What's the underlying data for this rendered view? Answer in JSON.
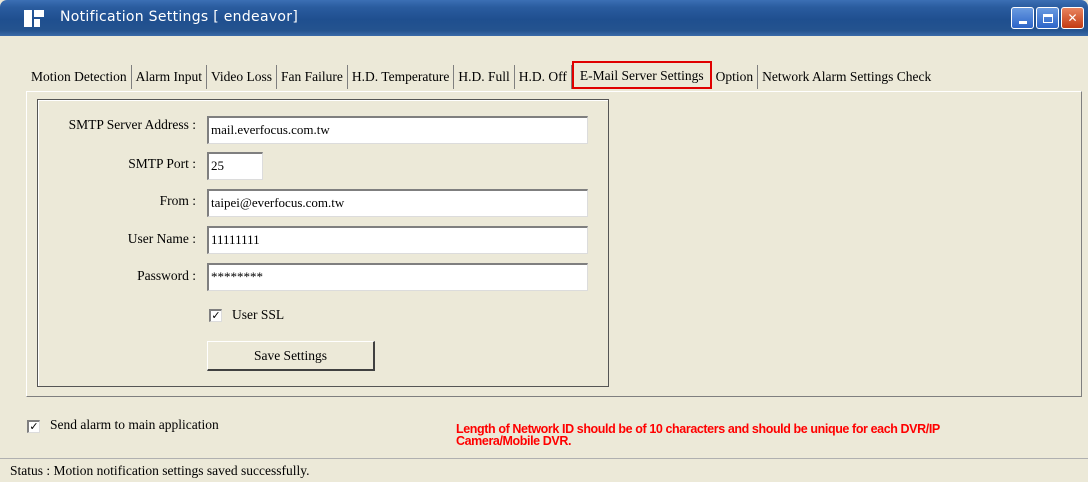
{
  "window": {
    "title": "Notification Settings  [ endeavor]",
    "min_icon": "minimize-icon",
    "max_icon": "maximize-icon",
    "close_icon": "close-icon"
  },
  "tabs": [
    {
      "label": "Motion Detection",
      "active": false
    },
    {
      "label": "Alarm Input",
      "active": false
    },
    {
      "label": "Video Loss",
      "active": false
    },
    {
      "label": "Fan Failure",
      "active": false
    },
    {
      "label": "H.D. Temperature",
      "active": false
    },
    {
      "label": "H.D. Full",
      "active": false
    },
    {
      "label": "H.D. Off",
      "active": false
    },
    {
      "label": "E-Mail Server Settings",
      "active": true
    },
    {
      "label": "Option",
      "active": false
    },
    {
      "label": "Network Alarm Settings Check",
      "active": false
    }
  ],
  "form": {
    "smtp_server_label": "SMTP Server Address :",
    "smtp_server_value": "mail.everfocus.com.tw",
    "smtp_port_label": "SMTP Port :",
    "smtp_port_value": "25",
    "from_label": "From :",
    "from_value": "taipei@everfocus.com.tw",
    "user_name_label": "User Name :",
    "user_name_value": "11111111",
    "password_label": "Password :",
    "password_value": "********",
    "ssl_label": "User SSL",
    "ssl_checked": true,
    "save_label": "Save Settings"
  },
  "send_alarm": {
    "label": "Send alarm to main application",
    "checked": true
  },
  "warning": {
    "line1": "Length of Network ID should be of 10 characters and should be unique for each DVR/IP",
    "line2": "Camera/Mobile DVR."
  },
  "status": {
    "text": "Status :  Motion notification settings saved successfully."
  },
  "colors": {
    "highlight": "#e00000",
    "warning": "#ff0000",
    "titlebar": "#1f4f8f"
  }
}
